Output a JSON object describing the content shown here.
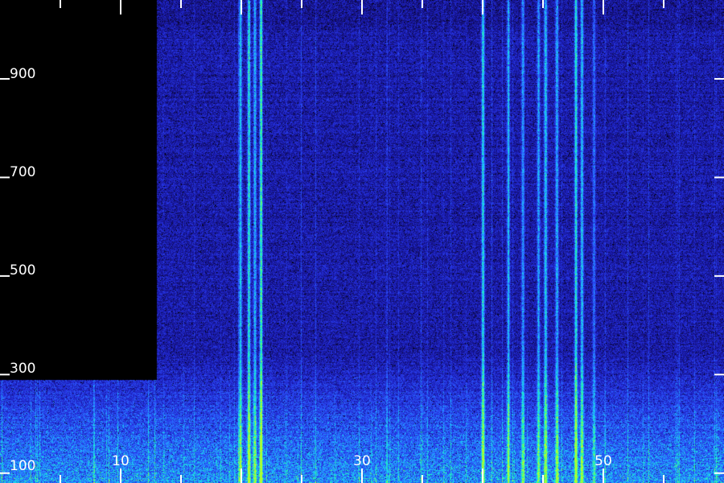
{
  "chart_data": {
    "type": "heatmap",
    "title": "",
    "xlabel": "",
    "ylabel": "",
    "xlim": [
      0,
      60
    ],
    "ylim": [
      80,
      1060
    ],
    "x_tick_labels": [
      {
        "x": 10,
        "label": "10"
      },
      {
        "x": 30,
        "label": "30"
      },
      {
        "x": 50,
        "label": "50"
      }
    ],
    "y_tick_labels": [
      {
        "y": 100,
        "label": "100"
      },
      {
        "y": 300,
        "label": "300"
      },
      {
        "y": 500,
        "label": "500"
      },
      {
        "y": 700,
        "label": "700"
      },
      {
        "y": 900,
        "label": "900"
      }
    ],
    "colormap": [
      "#000000",
      "#100a50",
      "#1818a8",
      "#2838e8",
      "#2a6cff",
      "#1fb3ff",
      "#18e8e0",
      "#28ff90",
      "#b0ff30"
    ],
    "no_data_regions": [
      {
        "x_range": [
          0,
          13.0
        ],
        "y_range": [
          290,
          1060
        ]
      }
    ],
    "emission_lines": [
      {
        "x": 19.9,
        "intensity": 0.6
      },
      {
        "x": 20.6,
        "intensity": 0.75
      },
      {
        "x": 21.1,
        "intensity": 0.55
      },
      {
        "x": 21.6,
        "intensity": 0.8
      },
      {
        "x": 40.0,
        "intensity": 0.7
      },
      {
        "x": 42.1,
        "intensity": 0.5
      },
      {
        "x": 43.3,
        "intensity": 0.45
      },
      {
        "x": 44.6,
        "intensity": 0.5
      },
      {
        "x": 45.2,
        "intensity": 0.6
      },
      {
        "x": 46.1,
        "intensity": 0.45
      },
      {
        "x": 47.7,
        "intensity": 0.75
      },
      {
        "x": 48.2,
        "intensity": 0.6
      },
      {
        "x": 49.2,
        "intensity": 0.35
      }
    ]
  }
}
